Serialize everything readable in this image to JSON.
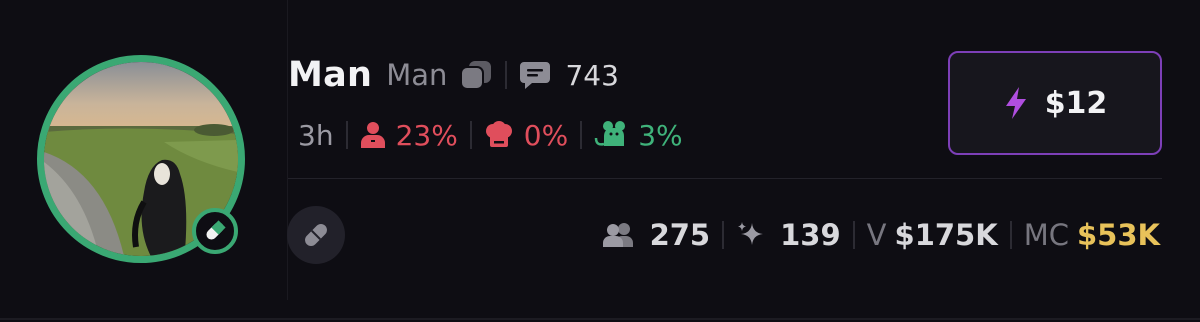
{
  "token": {
    "name": "Man",
    "ticker": "Man",
    "replies": "743",
    "age": "3h",
    "top_holder_pct": "23%",
    "dev_pct": "0%",
    "snipers_pct": "3%"
  },
  "buy_button": {
    "label": "$12"
  },
  "stats": {
    "holders": "275",
    "pro_traders": "139",
    "volume_label": "V",
    "volume": "$175K",
    "mcap_label": "MC",
    "mcap": "$53K"
  },
  "colors": {
    "accent_green": "#3aa873",
    "accent_purple": "#7d3fb8",
    "red": "#e04e5c",
    "gold": "#e8c25a"
  },
  "icons": [
    "copy-icon",
    "comment-icon",
    "user-icon",
    "chef-hat-icon",
    "rat-icon",
    "lightning-icon",
    "pill-icon",
    "users-icon",
    "sparkle-icon"
  ]
}
